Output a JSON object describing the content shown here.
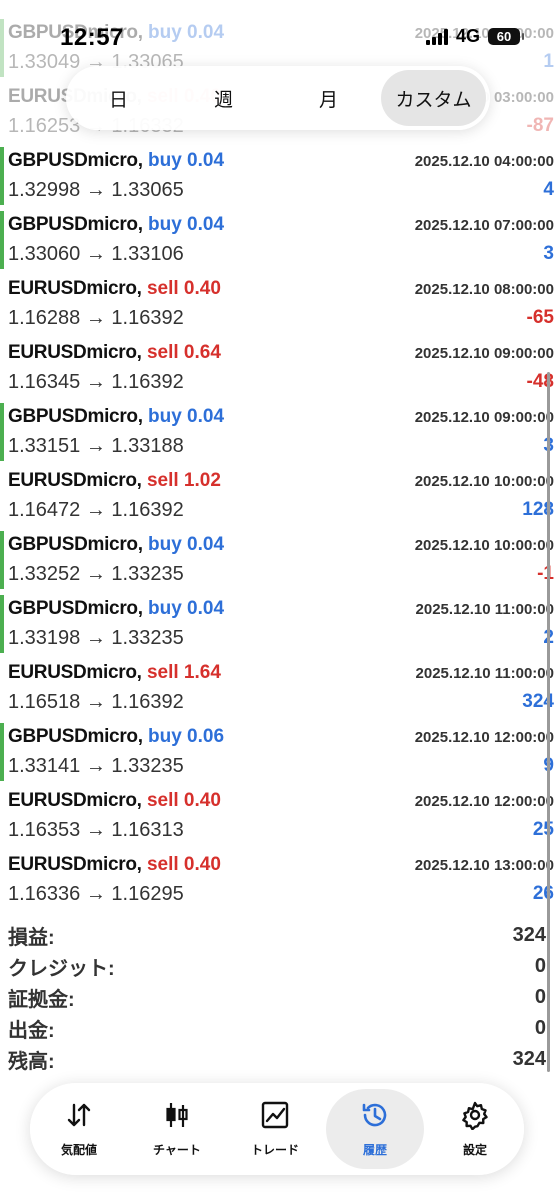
{
  "status_bar": {
    "time": "12:57",
    "network": "4G",
    "battery": "60"
  },
  "period_tabs": [
    {
      "label": "日",
      "active": false
    },
    {
      "label": "週",
      "active": false
    },
    {
      "label": "月",
      "active": false
    },
    {
      "label": "カスタム",
      "active": true
    }
  ],
  "trades": [
    {
      "symbol": "GBPUSDmicro,",
      "side": "buy",
      "volume": "buy 0.04",
      "date": "2025.12.10 03:00:00",
      "prices": "1.33049 → 1.33065",
      "profit": "1",
      "faded": true
    },
    {
      "symbol": "EURUSDmicro,",
      "side": "sell",
      "volume": "sell 0.40",
      "date": "2025.12.10 03:00:00",
      "prices": "1.16253 → 1.16332",
      "profit": "-87",
      "faded": true
    },
    {
      "symbol": "GBPUSDmicro,",
      "side": "buy",
      "volume": "buy 0.04",
      "date": "2025.12.10 04:00:00",
      "prices": "1.32998 → 1.33065",
      "profit": "4"
    },
    {
      "symbol": "GBPUSDmicro,",
      "side": "buy",
      "volume": "buy 0.04",
      "date": "2025.12.10 07:00:00",
      "prices": "1.33060 → 1.33106",
      "profit": "3"
    },
    {
      "symbol": "EURUSDmicro,",
      "side": "sell",
      "volume": "sell 0.40",
      "date": "2025.12.10 08:00:00",
      "prices": "1.16288 → 1.16392",
      "profit": "-65"
    },
    {
      "symbol": "EURUSDmicro,",
      "side": "sell",
      "volume": "sell 0.64",
      "date": "2025.12.10 09:00:00",
      "prices": "1.16345 → 1.16392",
      "profit": "-48"
    },
    {
      "symbol": "GBPUSDmicro,",
      "side": "buy",
      "volume": "buy 0.04",
      "date": "2025.12.10 09:00:00",
      "prices": "1.33151 → 1.33188",
      "profit": "3"
    },
    {
      "symbol": "EURUSDmicro,",
      "side": "sell",
      "volume": "sell 1.02",
      "date": "2025.12.10 10:00:00",
      "prices": "1.16472 → 1.16392",
      "profit": "128"
    },
    {
      "symbol": "GBPUSDmicro,",
      "side": "buy",
      "volume": "buy 0.04",
      "date": "2025.12.10 10:00:00",
      "prices": "1.33252 → 1.33235",
      "profit": "-1"
    },
    {
      "symbol": "GBPUSDmicro,",
      "side": "buy",
      "volume": "buy 0.04",
      "date": "2025.12.10 11:00:00",
      "prices": "1.33198 → 1.33235",
      "profit": "2"
    },
    {
      "symbol": "EURUSDmicro,",
      "side": "sell",
      "volume": "sell 1.64",
      "date": "2025.12.10 11:00:00",
      "prices": "1.16518 → 1.16392",
      "profit": "324"
    },
    {
      "symbol": "GBPUSDmicro,",
      "side": "buy",
      "volume": "buy 0.06",
      "date": "2025.12.10 12:00:00",
      "prices": "1.33141 → 1.33235",
      "profit": "9"
    },
    {
      "symbol": "EURUSDmicro,",
      "side": "sell",
      "volume": "sell 0.40",
      "date": "2025.12.10 12:00:00",
      "prices": "1.16353 → 1.16313",
      "profit": "25"
    },
    {
      "symbol": "EURUSDmicro,",
      "side": "sell",
      "volume": "sell 0.40",
      "date": "2025.12.10 13:00:00",
      "prices": "1.16336 → 1.16295",
      "profit": "26"
    }
  ],
  "summary": [
    {
      "label": "損益:",
      "value": "324"
    },
    {
      "label": "クレジット:",
      "value": "0"
    },
    {
      "label": "証拠金:",
      "value": "0"
    },
    {
      "label": "出金:",
      "value": "0"
    },
    {
      "label": "残高:",
      "value": "324"
    }
  ],
  "nav": [
    {
      "label": "気配値",
      "icon": "arrows-updown-icon",
      "active": false
    },
    {
      "label": "チャート",
      "icon": "candlestick-icon",
      "active": false
    },
    {
      "label": "トレード",
      "icon": "trend-chart-icon",
      "active": false
    },
    {
      "label": "履歴",
      "icon": "history-clock-icon",
      "active": true
    },
    {
      "label": "設定",
      "icon": "gear-icon",
      "active": false
    }
  ],
  "colors": {
    "buy": "#2d6fd8",
    "sell": "#d6302c",
    "accent_bar": "#4caf50",
    "nav_active": "#2d6fd8"
  }
}
